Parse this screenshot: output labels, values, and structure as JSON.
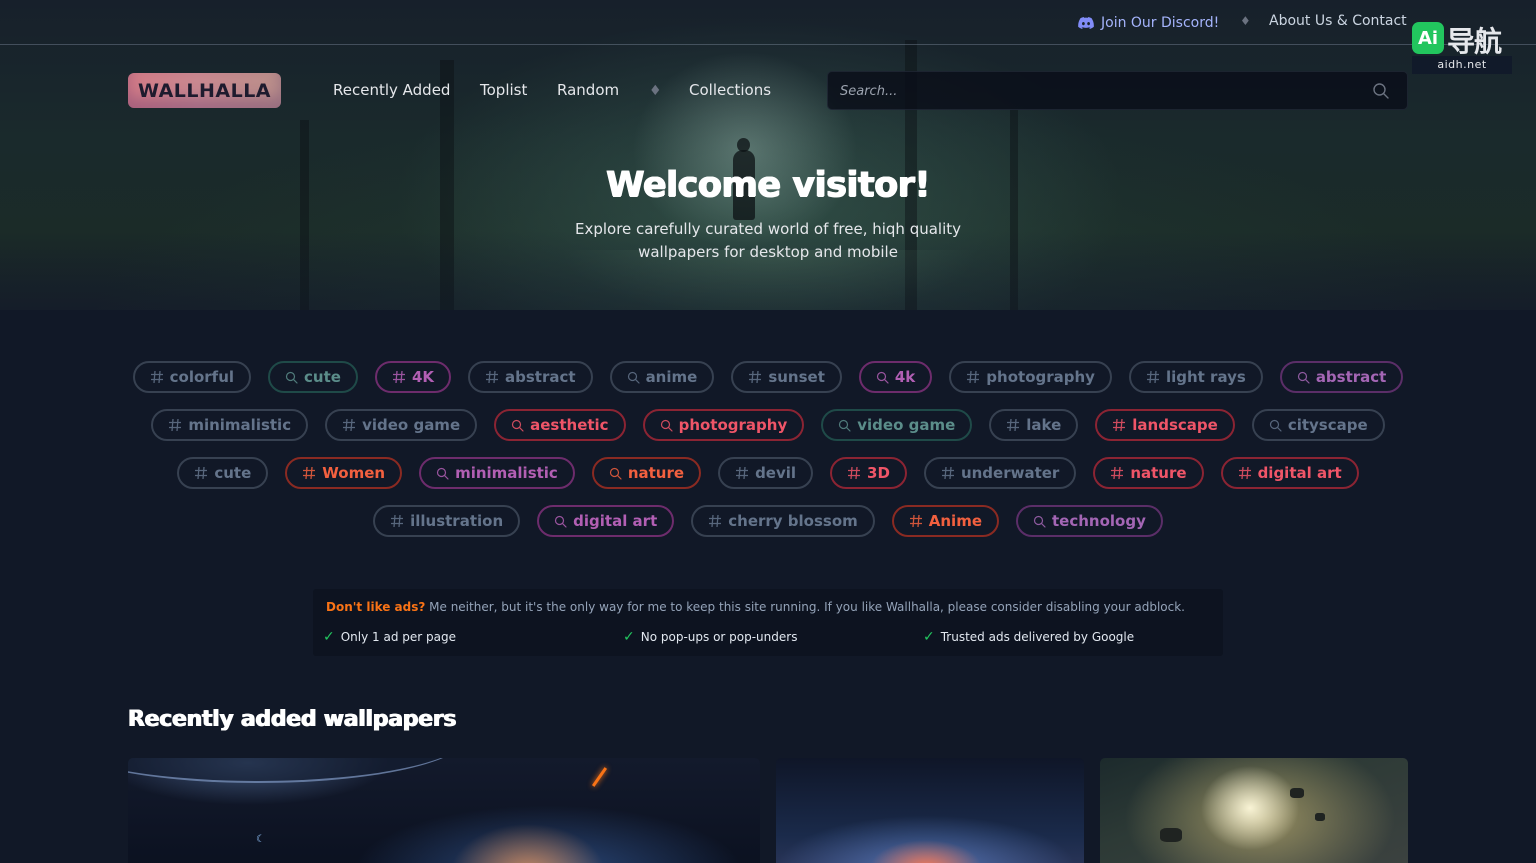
{
  "topbar": {
    "discord_label": "Join Our Discord!",
    "about_label": "About Us & Contact",
    "separator": "♦"
  },
  "watermark": {
    "logo_text": "Ai",
    "cn_text": "导航",
    "url": "aidh.net"
  },
  "brand": {
    "name": "WALLHALLA"
  },
  "nav": {
    "items": [
      "Recently Added",
      "Toplist",
      "Random",
      "Collections"
    ],
    "separator": "♦"
  },
  "search": {
    "placeholder": "Search..."
  },
  "hero": {
    "title": "Welcome visitor!",
    "subtitle": "Explore carefully curated world of free, hiqh quality wallpapers for desktop and mobile"
  },
  "tags": [
    [
      {
        "label": "colorful",
        "kind": "hash",
        "style": "slate"
      },
      {
        "label": "cute",
        "kind": "search",
        "style": "teal"
      },
      {
        "label": "4K",
        "kind": "hash",
        "style": "purple"
      },
      {
        "label": "abstract",
        "kind": "hash",
        "style": "slate"
      },
      {
        "label": "anime",
        "kind": "search",
        "style": "slate"
      },
      {
        "label": "sunset",
        "kind": "hash",
        "style": "slate"
      },
      {
        "label": "4k",
        "kind": "search",
        "style": "purple"
      },
      {
        "label": "photography",
        "kind": "hash",
        "style": "slate"
      },
      {
        "label": "light rays",
        "kind": "hash",
        "style": "slate"
      },
      {
        "label": "abstract",
        "kind": "search",
        "style": "violet"
      }
    ],
    [
      {
        "label": "minimalistic",
        "kind": "hash",
        "style": "slate"
      },
      {
        "label": "video game",
        "kind": "hash",
        "style": "slate"
      },
      {
        "label": "aesthetic",
        "kind": "search",
        "style": "red"
      },
      {
        "label": "photography",
        "kind": "search",
        "style": "red"
      },
      {
        "label": "video game",
        "kind": "search",
        "style": "teal"
      },
      {
        "label": "lake",
        "kind": "hash",
        "style": "slate"
      },
      {
        "label": "landscape",
        "kind": "hash",
        "style": "red"
      },
      {
        "label": "cityscape",
        "kind": "search",
        "style": "slate"
      }
    ],
    [
      {
        "label": "cute",
        "kind": "hash",
        "style": "slate"
      },
      {
        "label": "Women",
        "kind": "hash",
        "style": "orange"
      },
      {
        "label": "minimalistic",
        "kind": "search",
        "style": "purple"
      },
      {
        "label": "nature",
        "kind": "search",
        "style": "orange"
      },
      {
        "label": "devil",
        "kind": "hash",
        "style": "slate"
      },
      {
        "label": "3D",
        "kind": "hash",
        "style": "red"
      },
      {
        "label": "underwater",
        "kind": "hash",
        "style": "slate"
      },
      {
        "label": "nature",
        "kind": "hash",
        "style": "red"
      },
      {
        "label": "digital art",
        "kind": "hash",
        "style": "red"
      }
    ],
    [
      {
        "label": "illustration",
        "kind": "hash",
        "style": "slate"
      },
      {
        "label": "digital art",
        "kind": "search",
        "style": "purple"
      },
      {
        "label": "cherry blossom",
        "kind": "hash",
        "style": "slate"
      },
      {
        "label": "Anime",
        "kind": "hash",
        "style": "orange"
      },
      {
        "label": "technology",
        "kind": "search",
        "style": "violet"
      }
    ]
  ],
  "ad_notice": {
    "lead": "Don't like ads?",
    "text": " Me neither, but it's the only way for me to keep this site running. If you like Wallhalla, please consider disabling your adblock.",
    "checks": [
      "Only 1 ad per page",
      "No pop-ups or pop-unders",
      "Trusted ads delivered by Google"
    ]
  },
  "recent": {
    "title": "Recently added wallpapers"
  },
  "colors": {
    "background": "#111827",
    "discord": "#a5b4fc",
    "ad_lead": "#f97316",
    "check": "#22c55e"
  }
}
